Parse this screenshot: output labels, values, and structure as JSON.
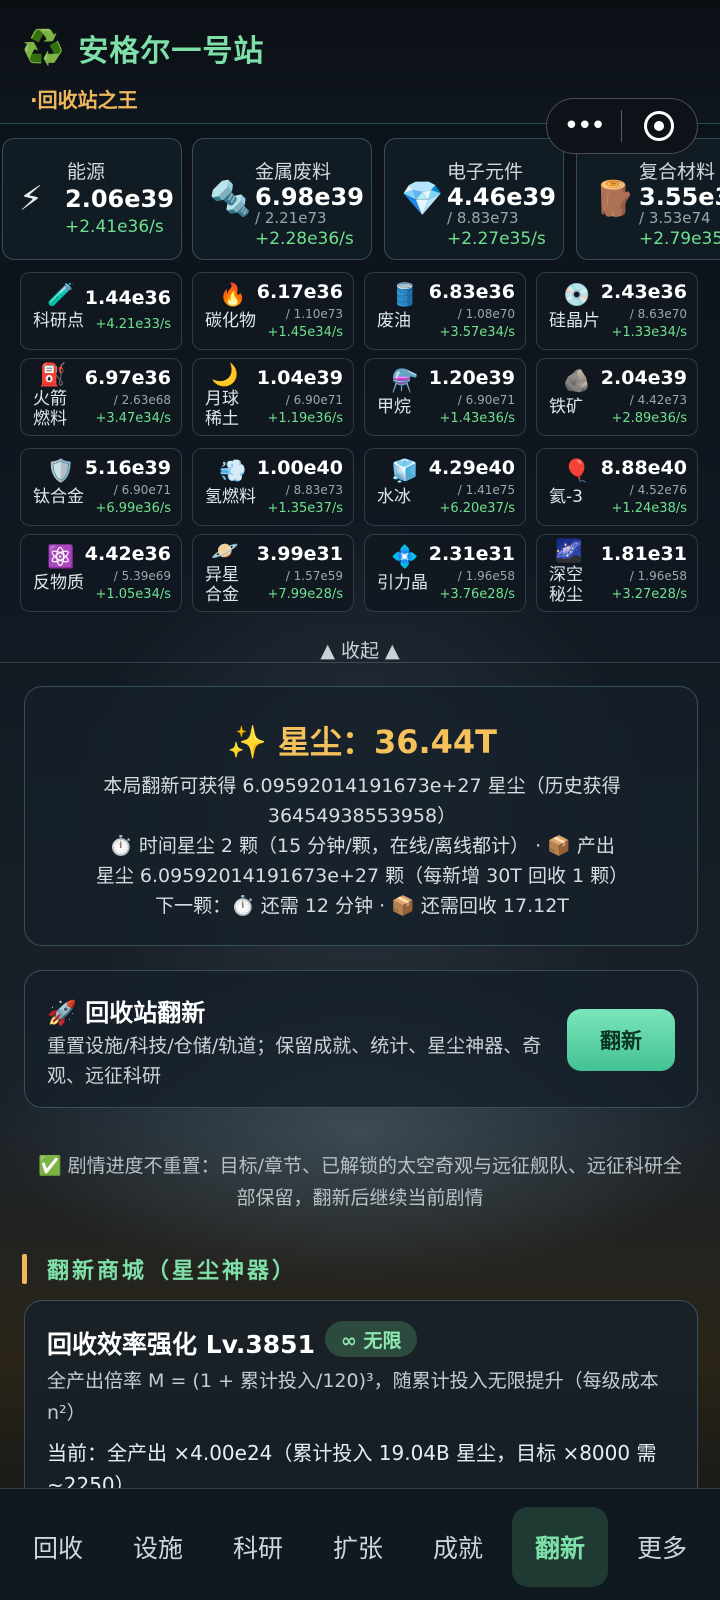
{
  "header": {
    "logo_icon": "recycle-icon",
    "logo_glyph": "♻️",
    "title": "安格尔一号站",
    "subtitle": "·回收站之王"
  },
  "capsule": {
    "more_glyph": "•••"
  },
  "top_resources": [
    {
      "icon": "lightning-icon",
      "glyph": "⚡",
      "label": "能源",
      "value": "2.06e39",
      "cap": "",
      "rate": "+2.41e36/s"
    },
    {
      "icon": "bolt-nut-icon",
      "glyph": "🔩",
      "label": "金属废料",
      "value": "6.98e39",
      "cap": "/ 2.21e73",
      "rate": "+2.28e36/s"
    },
    {
      "icon": "gem-icon",
      "glyph": "💎",
      "label": "电子元件",
      "value": "4.46e39",
      "cap": "/ 8.83e73",
      "rate": "+2.27e35/s"
    },
    {
      "icon": "log-icon",
      "glyph": "🪵",
      "label": "复合材料",
      "value": "3.55e3",
      "cap": "/ 3.53e74",
      "rate": "+2.79e35"
    }
  ],
  "resources": [
    {
      "icon": "test-tube-icon",
      "glyph": "🧪",
      "name": "科研点",
      "value": "1.44e36",
      "cap": "",
      "rate": "+4.21e33/s"
    },
    {
      "icon": "fire-icon",
      "glyph": "🔥",
      "name": "碳化物",
      "value": "6.17e36",
      "cap": "/ 1.10e73",
      "rate": "+1.45e34/s"
    },
    {
      "icon": "oil-drum-icon",
      "glyph": "🛢️",
      "name": "废油",
      "value": "6.83e36",
      "cap": "/ 1.08e70",
      "rate": "+3.57e34/s"
    },
    {
      "icon": "disc-icon",
      "glyph": "💿",
      "name": "硅晶片",
      "value": "2.43e36",
      "cap": "/ 8.63e70",
      "rate": "+1.33e34/s"
    },
    {
      "icon": "fuel-pump-icon",
      "glyph": "⛽",
      "name": "火箭燃料",
      "value": "6.97e36",
      "cap": "/ 2.63e68",
      "rate": "+3.47e34/s"
    },
    {
      "icon": "moon-icon",
      "glyph": "🌙",
      "name": "月球稀土",
      "value": "1.04e39",
      "cap": "/ 6.90e71",
      "rate": "+1.19e36/s"
    },
    {
      "icon": "flask-icon",
      "glyph": "⚗️",
      "name": "甲烷",
      "value": "1.20e39",
      "cap": "/ 6.90e71",
      "rate": "+1.43e36/s"
    },
    {
      "icon": "rock-icon",
      "glyph": "🪨",
      "name": "铁矿",
      "value": "2.04e39",
      "cap": "/ 4.42e73",
      "rate": "+2.89e36/s"
    },
    {
      "icon": "shield-icon",
      "glyph": "🛡️",
      "name": "钛合金",
      "value": "5.16e39",
      "cap": "/ 6.90e71",
      "rate": "+6.99e36/s"
    },
    {
      "icon": "dash-cloud-icon",
      "glyph": "💨",
      "name": "氢燃料",
      "value": "1.00e40",
      "cap": "/ 8.83e73",
      "rate": "+1.35e37/s"
    },
    {
      "icon": "ice-cube-icon",
      "glyph": "🧊",
      "name": "水冰",
      "value": "4.29e40",
      "cap": "/ 1.41e75",
      "rate": "+6.20e37/s"
    },
    {
      "icon": "balloon-icon",
      "glyph": "🎈",
      "name": "氦-3",
      "value": "8.88e40",
      "cap": "/ 4.52e76",
      "rate": "+1.24e38/s"
    },
    {
      "icon": "atom-icon",
      "glyph": "⚛️",
      "name": "反物质",
      "value": "4.42e36",
      "cap": "/ 5.39e69",
      "rate": "+1.05e34/s"
    },
    {
      "icon": "ringed-planet-icon",
      "glyph": "🪐",
      "name": "异星合金",
      "value": "3.99e31",
      "cap": "/ 1.57e59",
      "rate": "+7.99e28/s"
    },
    {
      "icon": "diamond-shape-icon",
      "glyph": "💠",
      "name": "引力晶",
      "value": "2.31e31",
      "cap": "/ 1.96e58",
      "rate": "+3.76e28/s"
    },
    {
      "icon": "milky-way-icon",
      "glyph": "🌌",
      "name": "深空秘尘",
      "value": "1.81e31",
      "cap": "/ 1.96e58",
      "rate": "+3.27e28/s"
    }
  ],
  "collapse_label": "▲ 收起 ▲",
  "stardust": {
    "title": "✨ 星尘：36.44T",
    "line1": "本局翻新可获得 6.09592014191673e+27 星尘（历史获得",
    "line2": "36454938553958）",
    "line3": "⏱️ 时间星尘 2 颗（15 分钟/颗，在线/离线都计） · 📦 产出",
    "line4": "星尘 6.09592014191673e+27 颗（每新增 30T 回收 1 颗）",
    "line5": "下一颗：⏱️ 还需 12 分钟 · 📦 还需回收 17.12T"
  },
  "rebirth": {
    "title": "🚀 回收站翻新",
    "desc": "重置设施/科技/仓储/轨道；保留成就、统计、星尘神器、奇观、远征科研",
    "button": "翻新"
  },
  "note": "✅ 剧情进度不重置：目标/章节、已解锁的太空奇观与远征舰队、远征科研全部保留，翻新后继续当前剧情",
  "shop": {
    "heading": "翻新商城（星尘神器）",
    "item": {
      "title": "回收效率强化 Lv.3851",
      "badge": "∞ 无限",
      "desc": "全产出倍率 M = (1 + 累计投入/120)³，随累计投入无限提升（每级成本 n²）",
      "current": "当前：全产出 ×4.00e24（累计投入 19.04B 星尘，目标 ×8000 需 ~2250）"
    }
  },
  "tabs": [
    "回收",
    "设施",
    "科研",
    "扩张",
    "成就",
    "翻新",
    "更多"
  ],
  "active_tab": "翻新"
}
